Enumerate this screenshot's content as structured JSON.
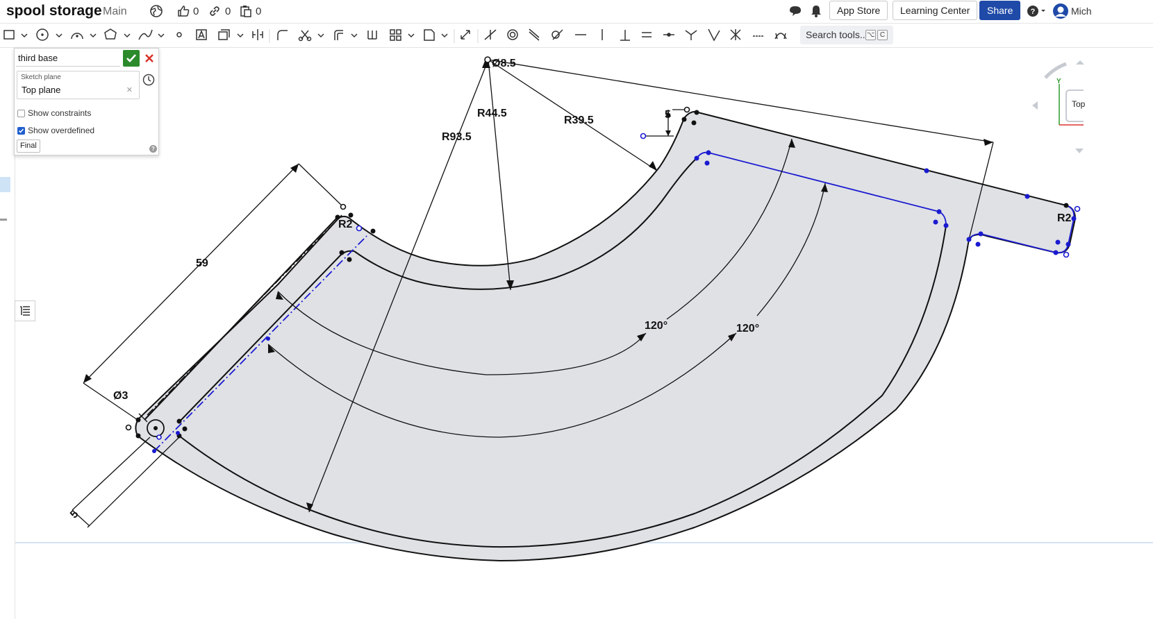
{
  "document": {
    "title": "spool storage",
    "branch": "Main"
  },
  "topbar": {
    "likes": "0",
    "links": "0",
    "copies": "0",
    "app_store": "App Store",
    "learning_center": "Learning Center",
    "share": "Share",
    "user_name": "Mich"
  },
  "toolbar": {
    "search_placeholder": "Search tools...",
    "search_shortcut_1": "⌥",
    "search_shortcut_2": "C",
    "tools": [
      "rectangle-icon",
      "circle-icon",
      "arc-icon",
      "polygon-icon",
      "spline-icon",
      "point-icon",
      "text-icon",
      "transform-icon",
      "mirror-icon",
      "fillet-icon",
      "trim-icon",
      "offset-icon",
      "pattern-icon",
      "linear-pattern-icon",
      "dxf-icon",
      "dimension-icon",
      "coincident-icon",
      "concentric-icon",
      "parallel-icon",
      "tangent-icon",
      "horizontal-icon",
      "vertical-icon",
      "perpendicular-icon",
      "equal-icon",
      "midpoint-icon",
      "normal-icon",
      "pierce-icon",
      "symmetric-icon",
      "fix-icon",
      "curvature-icon"
    ]
  },
  "sketch_dialog": {
    "name": "third base",
    "plane_label": "Sketch plane",
    "plane_value": "Top plane",
    "show_constraints_label": "Show constraints",
    "show_constraints_checked": false,
    "show_overdefined_label": "Show overdefined",
    "show_overdefined_checked": true,
    "final_label": "Final"
  },
  "view_cube": {
    "face_label": "Top",
    "axis_label": "Y"
  },
  "dimensions": {
    "r_small_center": "Ø8.5",
    "r_inner_arc": "R44.5",
    "r_outer_arc": "R39.5",
    "r_outermost": "R93.5",
    "length_59": "59",
    "diameter_3": "Ø3",
    "r2_left": "R2",
    "r2_right": "R2",
    "five_top": "5",
    "five_bottom": "5",
    "angle_inner": "120°",
    "angle_outer": "120°"
  },
  "colors": {
    "fill": "#dfe1e5",
    "edge": "#111111",
    "construction": "#1a1ad0",
    "share": "#1f4aa8",
    "accept": "#2b8a2b",
    "cancel": "#d93025"
  }
}
